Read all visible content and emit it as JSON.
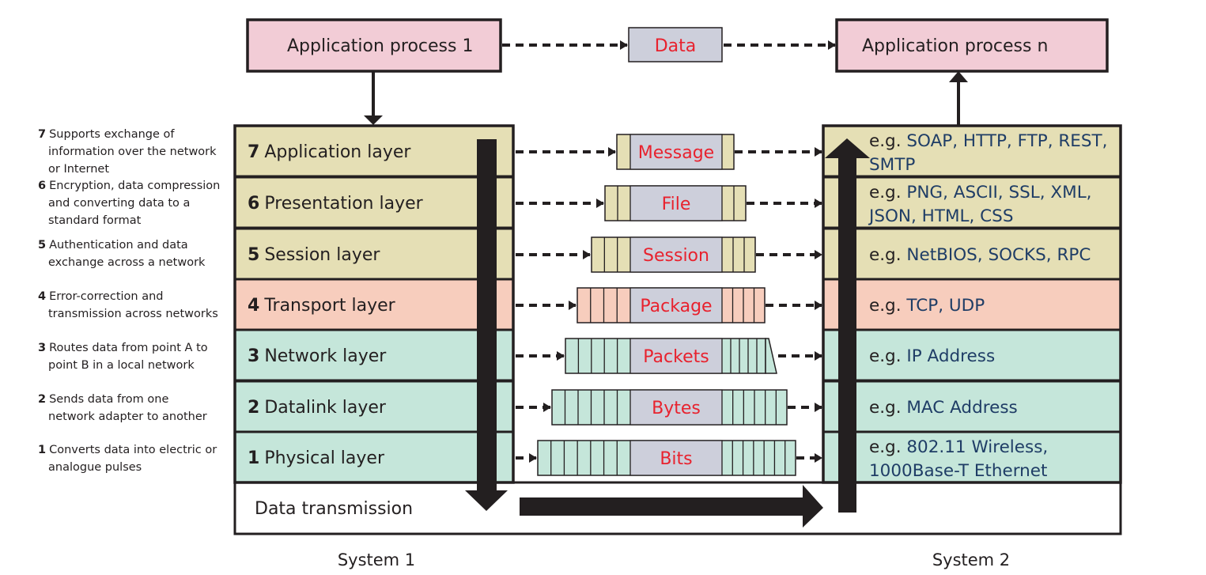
{
  "top": {
    "app1": "Application process 1",
    "data": "Data",
    "appn": "Application process n"
  },
  "colors": {
    "pink": "#f2ccd6",
    "khaki": "#e5dfb5",
    "salmon": "#f7cdbd",
    "mint": "#c5e6da",
    "grey": "#cdcfdb",
    "red_text": "#e8222e",
    "blue_text": "#1f3d66"
  },
  "layers": [
    {
      "num": "7",
      "name": "Application layer",
      "desc": [
        "Supports exchange of",
        "information over the network",
        "or Internet"
      ],
      "unit": "Message",
      "segments": [
        1,
        1
      ],
      "eg": "e.g.",
      "examples": [
        " SOAP, HTTP, FTP, REST,",
        "SMTP"
      ],
      "color": "khaki"
    },
    {
      "num": "6",
      "name": "Presentation layer",
      "desc": [
        "Encryption, data compression",
        "and converting data to a",
        "standard format"
      ],
      "unit": "File",
      "segments": [
        2,
        2
      ],
      "eg": "e.g.",
      "examples": [
        " PNG, ASCII, SSL, XML,",
        "JSON,  HTML, CSS"
      ],
      "color": "khaki"
    },
    {
      "num": "5",
      "name": "Session layer",
      "desc": [
        "Authentication and data",
        "exchange across a network"
      ],
      "unit": "Session",
      "segments": [
        3,
        3
      ],
      "eg": "e.g.",
      "examples": [
        " NetBIOS, SOCKS, RPC"
      ],
      "color": "khaki"
    },
    {
      "num": "4",
      "name": "Transport layer",
      "desc": [
        "Error-correction and",
        "transmission across networks"
      ],
      "unit": "Package",
      "segments": [
        4,
        4
      ],
      "eg": "e.g.",
      "examples": [
        " TCP, UDP"
      ],
      "color": "salmon"
    },
    {
      "num": "3",
      "name": "Network layer",
      "desc": [
        "Routes data from point A to",
        "point B in a local network"
      ],
      "unit": "Packets",
      "segments": [
        5,
        5
      ],
      "eg": "e.g.",
      "examples": [
        " IP Address"
      ],
      "color": "mint"
    },
    {
      "num": "2",
      "name": "Datalink layer",
      "desc": [
        "Sends data from one",
        "network adapter to another"
      ],
      "unit": "Bytes",
      "segments": [
        6,
        6
      ],
      "eg": "e.g.",
      "examples": [
        " MAC Address"
      ],
      "color": "mint"
    },
    {
      "num": "1",
      "name": "Physical layer",
      "desc": [
        "Converts data into electric or",
        "analogue pulses"
      ],
      "unit": "Bits",
      "segments": [
        7,
        7
      ],
      "eg": "e.g.",
      "examples": [
        " 802.11 Wireless,",
        "1000Base-T Ethernet"
      ],
      "color": "mint"
    }
  ],
  "bottom": {
    "transmission": "Data transmission",
    "system1": "System 1",
    "system2": "System 2"
  }
}
